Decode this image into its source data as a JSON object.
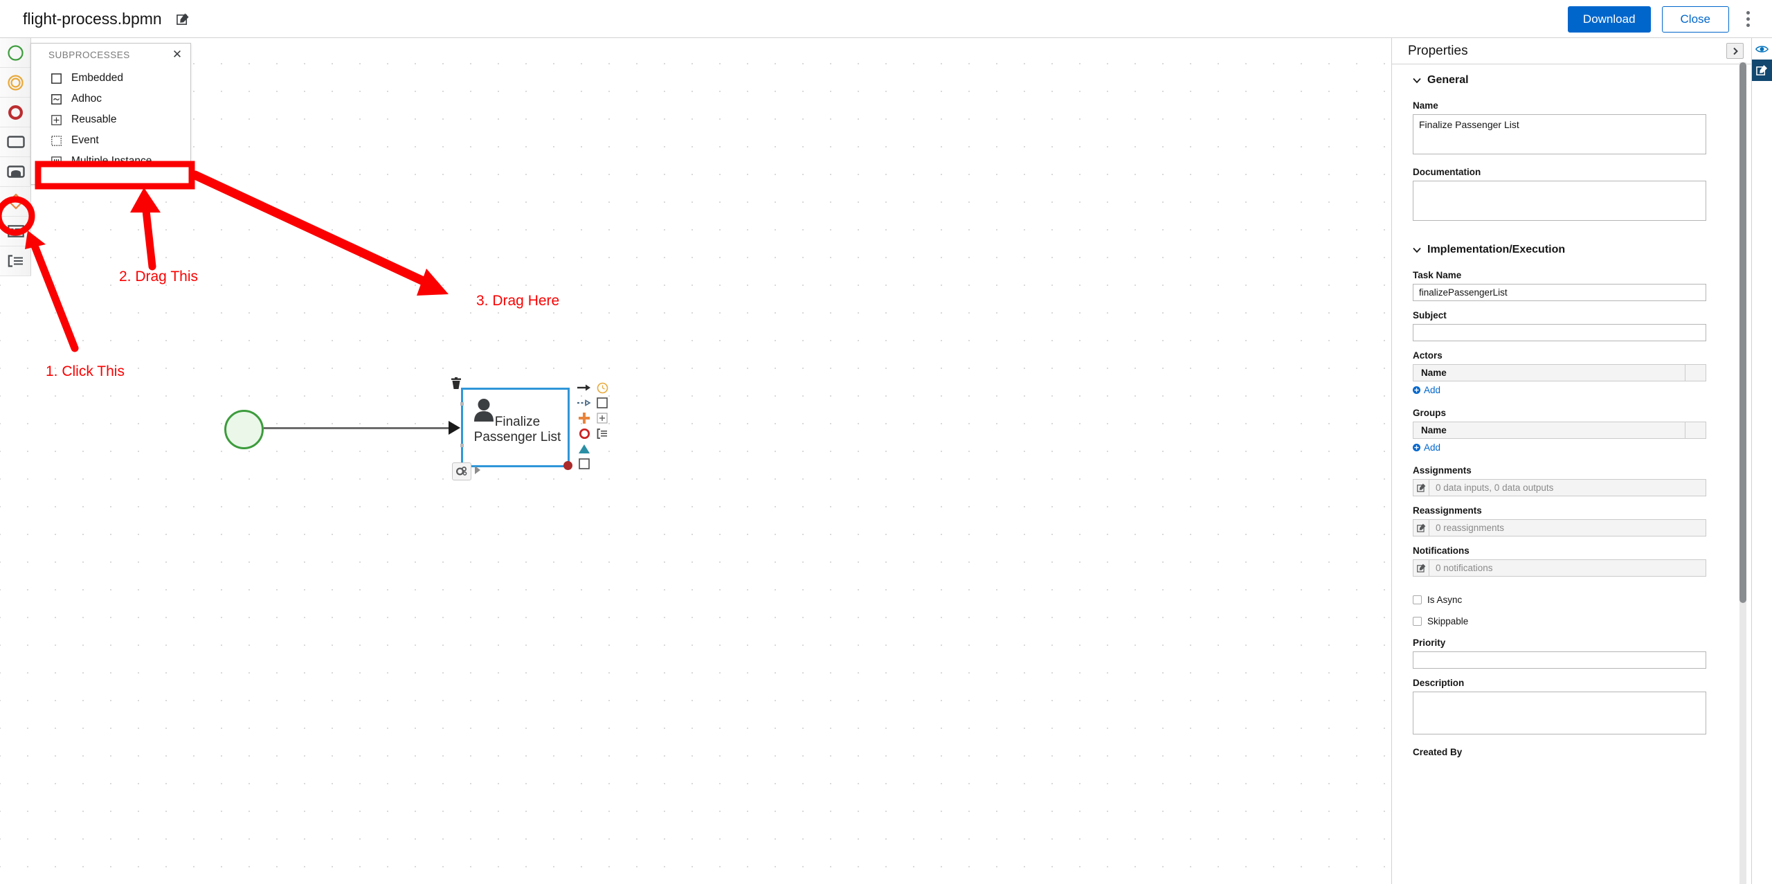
{
  "header": {
    "file_title": "flight-process.bpmn",
    "edit_icon": "edit-pencil-icon",
    "download_label": "Download",
    "close_label": "Close",
    "kebab_icon": "kebab-menu-icon"
  },
  "palette": {
    "items": [
      {
        "name": "start-event-tool",
        "icon": "green-circle-icon"
      },
      {
        "name": "intermediate-event-tool",
        "icon": "orange-double-circle-icon"
      },
      {
        "name": "end-event-tool",
        "icon": "red-thick-circle-icon"
      },
      {
        "name": "task-tool",
        "icon": "rounded-rectangle-icon"
      },
      {
        "name": "subprocess-tool",
        "icon": "subprocess-icon"
      },
      {
        "name": "gateway-tool",
        "icon": "orange-diamond-icon"
      },
      {
        "name": "data-object-tool",
        "icon": "table-list-icon"
      },
      {
        "name": "swimlane-tool",
        "icon": "swimlane-bracket-icon"
      }
    ]
  },
  "popup": {
    "title": "SUBPROCESSES",
    "close_icon": "close-x-icon",
    "items": [
      {
        "label": "Embedded",
        "icon": "embedded-subprocess-icon"
      },
      {
        "label": "Adhoc",
        "icon": "adhoc-subprocess-icon"
      },
      {
        "label": "Reusable",
        "icon": "reusable-subprocess-icon"
      },
      {
        "label": "Event",
        "icon": "event-subprocess-icon",
        "highlighted": true
      },
      {
        "label": "Multiple Instance",
        "icon": "multiple-instance-icon"
      }
    ]
  },
  "annotations": {
    "step1": "1. Click This",
    "step2": "2. Drag This",
    "step3": "3. Drag Here",
    "color": "#fb0000"
  },
  "diagram": {
    "start_event_name": "start-event",
    "task_label": "Finalize\nPassenger List",
    "task_label_line1": "Finalize",
    "task_label_line2": "Passenger List",
    "task_type_icon": "user-task-icon",
    "trash_icon": "trash-icon",
    "gear_icon": "gear-settings-icon",
    "context_pad": [
      {
        "name": "append-sequence-flow-icon",
        "glyph": "arrow-right"
      },
      {
        "name": "append-timer-event-icon",
        "glyph": "timer-circle"
      },
      {
        "name": "append-message-flow-icon",
        "glyph": "dashed-arrow"
      },
      {
        "name": "append-task-icon",
        "glyph": "square"
      },
      {
        "name": "add-plus-icon",
        "glyph": "plus"
      },
      {
        "name": "append-reusable-icon",
        "glyph": "plus-square"
      },
      {
        "name": "append-end-event-icon",
        "glyph": "red-circle"
      },
      {
        "name": "append-lane-icon",
        "glyph": "lane-bracket"
      },
      {
        "name": "append-gateway-icon",
        "glyph": "triangle"
      },
      {
        "name": "append-subprocess-icon",
        "glyph": "empty-square"
      }
    ]
  },
  "properties": {
    "title": "Properties",
    "collapse_icon": "chevron-right-icon",
    "sections": [
      {
        "label": "General"
      },
      {
        "label": "Implementation/Execution"
      }
    ],
    "name_label": "Name",
    "name_value": "Finalize Passenger List",
    "documentation_label": "Documentation",
    "documentation_value": "",
    "impl_label": "Implementation/Execution",
    "task_name_label": "Task Name",
    "task_name_value": "finalizePassengerList",
    "subject_label": "Subject",
    "subject_value": "",
    "actors_label": "Actors",
    "actors_col_name": "Name",
    "actors_add": "Add",
    "groups_label": "Groups",
    "groups_col_name": "Name",
    "groups_add": "Add",
    "assignments_label": "Assignments",
    "assignments_value": "0 data inputs, 0 data outputs",
    "reassignments_label": "Reassignments",
    "reassignments_value": "0 reassignments",
    "notifications_label": "Notifications",
    "notifications_value": "0 notifications",
    "is_async_label": "Is Async",
    "skippable_label": "Skippable",
    "priority_label": "Priority",
    "priority_value": "",
    "description_label": "Description",
    "description_value": "",
    "created_by_label": "Created By"
  },
  "right_rail": {
    "preview_icon": "eye-preview-icon",
    "edit_icon": "edit-properties-icon"
  },
  "colors": {
    "primary_blue": "#0066cc",
    "annotation_red": "#fb0000",
    "start_event_green": "#3c9c3c",
    "selection_blue": "#2f96d8",
    "rail_active": "#12476f"
  }
}
